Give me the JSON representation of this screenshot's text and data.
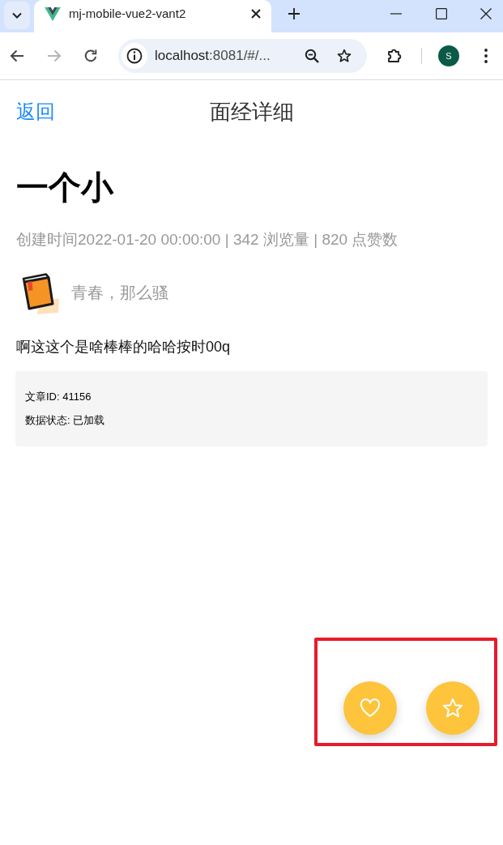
{
  "browser": {
    "tabs": [
      {
        "title": "mj-mobile-vue2-vant2",
        "selected": true
      }
    ],
    "forward": {
      "disabled": true
    },
    "address": "localhost:8081/#/...",
    "profile": "S"
  },
  "nav_bar": {
    "back": "返回",
    "title": "面经详细"
  },
  "article": {
    "title": "一个小",
    "meta": "创建时间2022-01-20 00:00:00 | 342 浏览量 | 820 点赞数",
    "author": {
      "name": "青春，那么骚"
    },
    "content": "啊这这个是啥棒棒的哈哈按时00q",
    "info": [
      "文章ID: 41156",
      "数据状态: 已加载"
    ]
  },
  "actions": [
    {
      "kind": "like",
      "active": false
    },
    {
      "kind": "collect",
      "active": false
    }
  ],
  "highlight": {
    "kind": "rectangle"
  }
}
